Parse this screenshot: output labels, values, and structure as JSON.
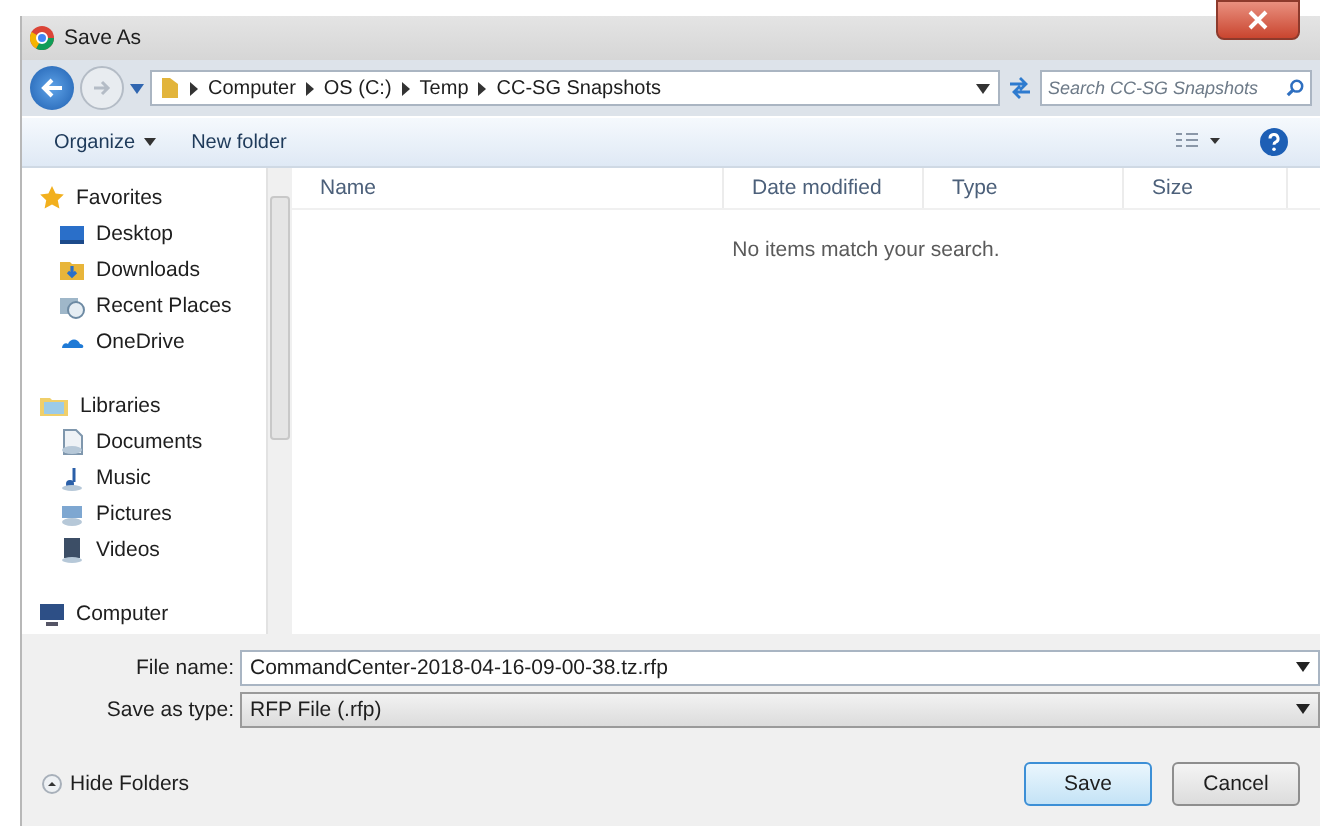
{
  "window": {
    "title": "Save As"
  },
  "address": {
    "path": [
      {
        "label": "Computer"
      },
      {
        "label": "OS (C:)"
      },
      {
        "label": "Temp"
      },
      {
        "label": "CC-SG Snapshots"
      }
    ]
  },
  "search": {
    "placeholder": "Search CC-SG Snapshots"
  },
  "toolbar": {
    "items": [
      {
        "label": "Organize",
        "kind": "menu"
      },
      {
        "label": "New folder",
        "kind": "button"
      }
    ]
  },
  "nav": {
    "groups": [
      {
        "label": "Favorites",
        "kind": "star",
        "children": [
          {
            "label": "Desktop",
            "kind": "desktop"
          },
          {
            "label": "Downloads",
            "kind": "download"
          },
          {
            "label": "Recent Places",
            "kind": "recent"
          },
          {
            "label": "OneDrive",
            "kind": "cloud"
          }
        ]
      },
      {
        "label": "Libraries",
        "kind": "library",
        "children": [
          {
            "label": "Documents",
            "kind": "document"
          },
          {
            "label": "Music",
            "kind": "music"
          },
          {
            "label": "Pictures",
            "kind": "picture"
          },
          {
            "label": "Videos",
            "kind": "video"
          }
        ]
      },
      {
        "label": "Computer",
        "kind": "computer"
      }
    ]
  },
  "file_list": {
    "columns": [
      {
        "label": "Name"
      },
      {
        "label": "Date modified"
      },
      {
        "label": "Type"
      },
      {
        "label": "Size"
      }
    ],
    "empty_message": "No items match your search."
  },
  "fields": [
    {
      "label": "File name:",
      "value": "CommandCenter-2018-04-16-09-00-38.tz.rfp",
      "kind": "edit"
    },
    {
      "label": "Save as type:",
      "value": "RFP File (.rfp)",
      "kind": "dropdown"
    }
  ],
  "hide_folders": "Hide Folders",
  "buttons": [
    {
      "label": "Save",
      "default": true
    },
    {
      "label": "Cancel",
      "default": false
    }
  ]
}
